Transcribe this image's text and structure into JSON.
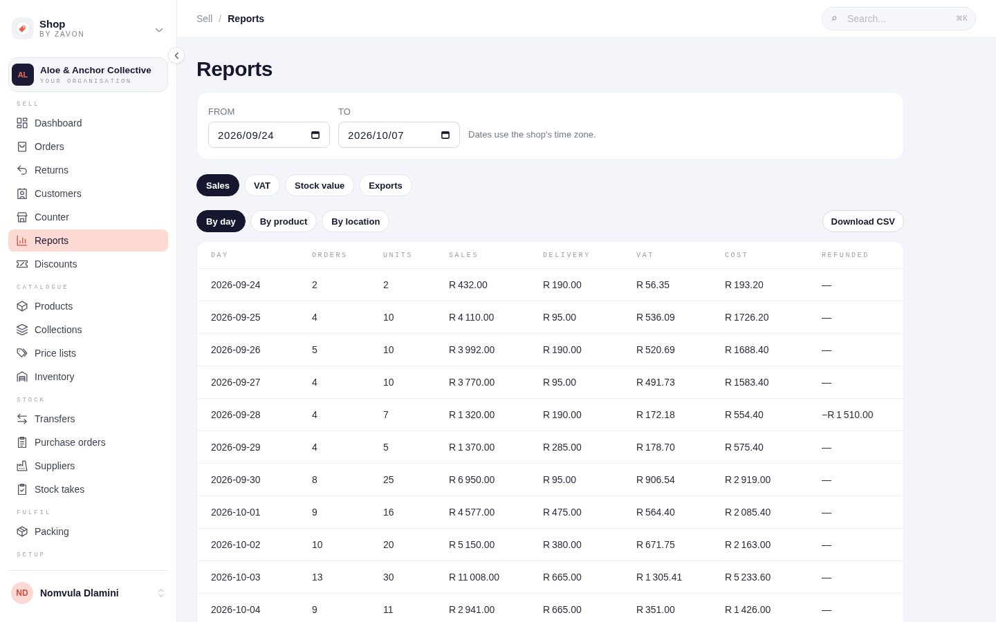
{
  "sidebar": {
    "brand": {
      "name": "Shop",
      "tagline": "BY ZAVON"
    },
    "organisation": {
      "initials": "AL",
      "name": "Aloe & Anchor Collective",
      "caption": "YOUR ORGANISATION"
    },
    "sections": [
      {
        "label": "SELL",
        "items": [
          {
            "label": "Dashboard",
            "selected": false
          },
          {
            "label": "Orders",
            "selected": false
          },
          {
            "label": "Returns",
            "selected": false
          },
          {
            "label": "Customers",
            "selected": false
          },
          {
            "label": "Counter",
            "selected": false
          },
          {
            "label": "Reports",
            "selected": true
          },
          {
            "label": "Discounts",
            "selected": false
          }
        ]
      },
      {
        "label": "CATALOGUE",
        "items": [
          {
            "label": "Products",
            "selected": false
          },
          {
            "label": "Collections",
            "selected": false
          },
          {
            "label": "Price lists",
            "selected": false
          },
          {
            "label": "Inventory",
            "selected": false
          }
        ]
      },
      {
        "label": "STOCK",
        "items": [
          {
            "label": "Transfers",
            "selected": false
          },
          {
            "label": "Purchase orders",
            "selected": false
          },
          {
            "label": "Suppliers",
            "selected": false
          },
          {
            "label": "Stock takes",
            "selected": false
          }
        ]
      },
      {
        "label": "FULFIL",
        "items": [
          {
            "label": "Packing",
            "selected": false
          }
        ]
      },
      {
        "label": "SETUP"
      }
    ],
    "user": {
      "initials": "ND",
      "name": "Nomvula Dlamini"
    }
  },
  "breadcrumb": {
    "separator": "/",
    "items": [
      {
        "label": "Sell",
        "current": false
      },
      {
        "label": "Reports",
        "current": true
      }
    ]
  },
  "search": {
    "placeholder": "Search...",
    "shortcut": "⌘K"
  },
  "page_title": "Reports",
  "date_filter": {
    "fields": [
      {
        "label": "FROM",
        "value": "2026/09/24"
      },
      {
        "label": "TO",
        "value": "2026/10/07"
      }
    ],
    "hint": "Dates use the shop's time zone."
  },
  "report_tabs": [
    {
      "label": "Sales",
      "selected": true
    },
    {
      "label": "VAT",
      "selected": false
    },
    {
      "label": "Stock value",
      "selected": false
    },
    {
      "label": "Exports",
      "selected": false
    }
  ],
  "group_tabs": [
    {
      "label": "By day",
      "selected": true
    },
    {
      "label": "By product",
      "selected": false
    },
    {
      "label": "By location",
      "selected": false
    }
  ],
  "download_button": "Download CSV",
  "table": {
    "columns": [
      "DAY",
      "ORDERS",
      "UNITS",
      "SALES",
      "DELIVERY",
      "VAT",
      "COST",
      "REFUNDED"
    ],
    "rows": [
      [
        "2026-09-24",
        "2",
        "2",
        "R 432.00",
        "R 190.00",
        "R 56.35",
        "R 193.20",
        "—"
      ],
      [
        "2026-09-25",
        "4",
        "10",
        "R 4 110.00",
        "R 95.00",
        "R 536.09",
        "R 1726.20",
        "—"
      ],
      [
        "2026-09-26",
        "5",
        "10",
        "R 3 992.00",
        "R 190.00",
        "R 520.69",
        "R 1688.40",
        "—"
      ],
      [
        "2026-09-27",
        "4",
        "10",
        "R 3 770.00",
        "R 95.00",
        "R 491.73",
        "R 1583.40",
        "—"
      ],
      [
        "2026-09-28",
        "4",
        "7",
        "R 1 320.00",
        "R 190.00",
        "R 172.18",
        "R 554.40",
        "−R 1 510.00"
      ],
      [
        "2026-09-29",
        "4",
        "5",
        "R 1 370.00",
        "R 285.00",
        "R 178.70",
        "R 575.40",
        "—"
      ],
      [
        "2026-09-30",
        "8",
        "25",
        "R 6 950.00",
        "R 95.00",
        "R 906.54",
        "R 2 919.00",
        "—"
      ],
      [
        "2026-10-01",
        "9",
        "16",
        "R 4 577.00",
        "R 475.00",
        "R 564.40",
        "R 2 085.40",
        "—"
      ],
      [
        "2026-10-02",
        "10",
        "20",
        "R 5 150.00",
        "R 380.00",
        "R 671.75",
        "R 2 163.00",
        "—"
      ],
      [
        "2026-10-03",
        "13",
        "30",
        "R 11 008.00",
        "R 665.00",
        "R 1 305.41",
        "R 5 233.60",
        "—"
      ],
      [
        "2026-10-04",
        "9",
        "11",
        "R 2 941.00",
        "R 665.00",
        "R 351.00",
        "R 1 426.00",
        "—"
      ]
    ]
  }
}
